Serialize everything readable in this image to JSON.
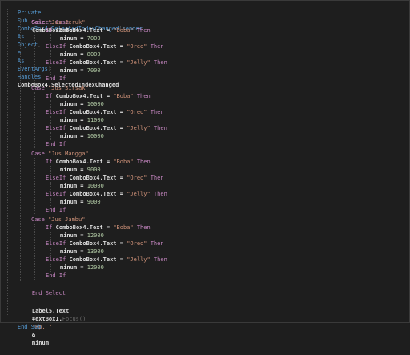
{
  "code": {
    "sub_header": {
      "private": "Private",
      "sub": "Sub",
      "name": "ComboBox4_SelectedIndexChanged",
      "p1": "sender",
      "as1": "As",
      "t1": "Object",
      "p2": "e",
      "as2": "As",
      "t2": "EventArgs",
      "handles": "Handles",
      "target": "ComboBox4.SelectedIndexChanged"
    },
    "select_line": {
      "kw": "Select Case",
      "expr": "ComboBox2.Text"
    },
    "cases": [
      {
        "case": "Case",
        "value": "\"Jus Jeruk\"",
        "prices": [
          "7000",
          "8000",
          "7000"
        ]
      },
      {
        "case": "Case",
        "value": "\"Jus Sirsak\"",
        "prices": [
          "10000",
          "11000",
          "10000"
        ]
      },
      {
        "case": "Case",
        "value": "\"Jus Mangga\"",
        "prices": [
          "9000",
          "10000",
          "9000"
        ]
      },
      {
        "case": "Case",
        "value": "\"Jus Jambu\"",
        "prices": [
          "12000",
          "13000",
          "12000"
        ]
      }
    ],
    "branch": {
      "if": "If",
      "elseif": "ElseIf",
      "then": "Then",
      "endif": "End If",
      "combo": "ComboBox4.Text",
      "eq": "=",
      "opts": [
        "\"Boba\"",
        "\"Oreo\"",
        "\"Jelly\""
      ],
      "var": "minum",
      "assign": "="
    },
    "end_select": "End Select",
    "label_line": {
      "target": "Label5.Text",
      "eq": "=",
      "str": "\"Rp. \"",
      "amp": "&",
      "var": "minum"
    },
    "focus_line": {
      "target": "TextBox1.",
      "method": "Focus()"
    },
    "end_sub": "End Sub"
  },
  "colors": {
    "background": "#1e1e1e",
    "keyword": "#569cd6",
    "control": "#c586c0",
    "identifier": "#dcdcdc",
    "string": "#ce9178",
    "type": "#4ec9b0"
  }
}
